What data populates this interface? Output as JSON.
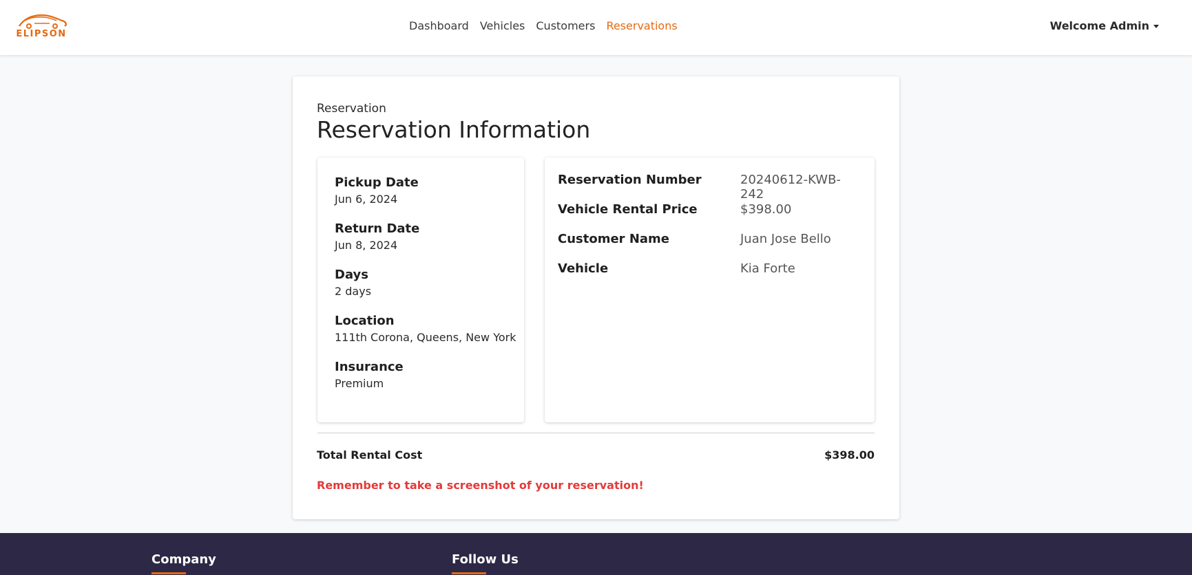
{
  "brand": {
    "name": "ELIPSON",
    "accent_color": "#e56a12"
  },
  "nav": {
    "links": [
      {
        "label": "Dashboard",
        "active": false
      },
      {
        "label": "Vehicles",
        "active": false
      },
      {
        "label": "Customers",
        "active": false
      },
      {
        "label": "Reservations",
        "active": true
      }
    ],
    "user_menu": "Welcome Admin"
  },
  "reservation": {
    "eyebrow": "Reservation",
    "title": "Reservation Information",
    "details": {
      "pickup_date": {
        "label": "Pickup Date",
        "value": "Jun 6, 2024"
      },
      "return_date": {
        "label": "Return Date",
        "value": "Jun 8, 2024"
      },
      "days": {
        "label": "Days",
        "value": "2 days"
      },
      "location": {
        "label": "Location",
        "value": "111th Corona, Queens, New York"
      },
      "insurance": {
        "label": "Insurance",
        "value": "Premium"
      }
    },
    "summary": {
      "reservation_number": {
        "label": "Reservation Number",
        "value": "20240612-KWB-242"
      },
      "rental_price": {
        "label": "Vehicle Rental Price",
        "value": "$398.00"
      },
      "customer_name": {
        "label": "Customer Name",
        "value": "Juan Jose Bello"
      },
      "vehicle": {
        "label": "Vehicle",
        "value": "Kia Forte"
      }
    },
    "total": {
      "label": "Total Rental Cost",
      "value": "$398.00"
    },
    "reminder": "Remember to take a screenshot of your reservation!",
    "reminder_color": "#e33a3a"
  },
  "footer": {
    "headings": [
      "Company",
      "Follow Us"
    ],
    "background_color": "#2d2846"
  }
}
